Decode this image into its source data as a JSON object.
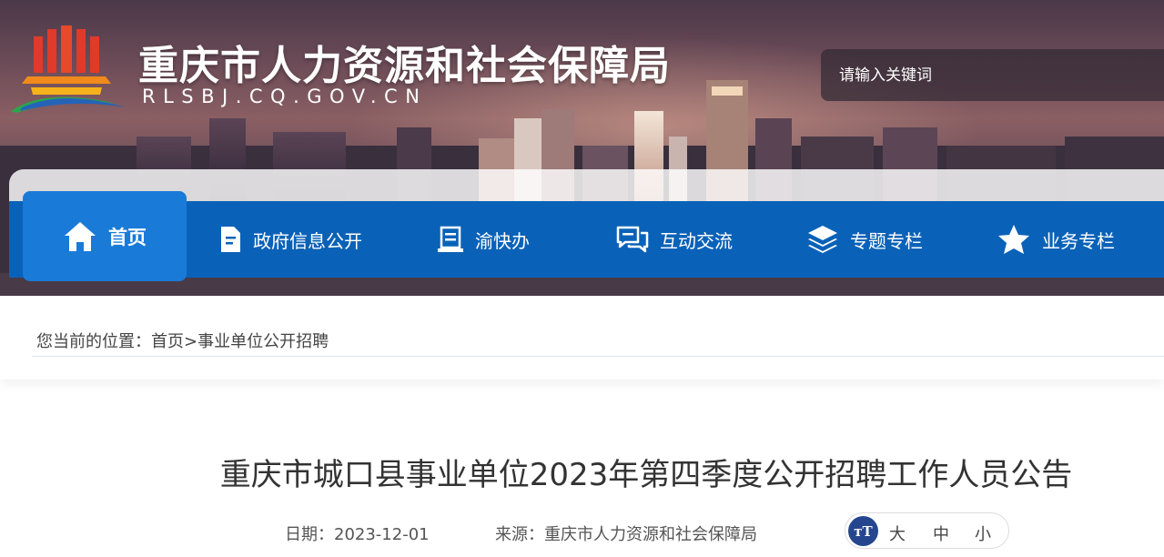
{
  "header": {
    "site_name": "重庆市人力资源和社会保障局",
    "site_domain": "RLSBJ.CQ.GOV.CN",
    "search_placeholder": "请输入关键词"
  },
  "nav": {
    "items": [
      {
        "label": "首页",
        "icon": "home-icon",
        "active": true
      },
      {
        "label": "政府信息公开",
        "icon": "document-icon"
      },
      {
        "label": "渝快办",
        "icon": "clipboard-icon"
      },
      {
        "label": "互动交流",
        "icon": "chat-icon"
      },
      {
        "label": "专题专栏",
        "icon": "layers-icon"
      },
      {
        "label": "业务专栏",
        "icon": "star-icon"
      }
    ]
  },
  "breadcrumb": {
    "prefix": "您当前的位置：",
    "home": "首页",
    "separator": ">",
    "current": "事业单位公开招聘"
  },
  "article": {
    "title": "重庆市城口县事业单位2023年第四季度公开招聘工作人员公告",
    "date_label": "日期：",
    "date": "2023-12-01",
    "source_label": "来源：",
    "source": "重庆市人力资源和社会保障局",
    "font_icon_text": "тT",
    "font_large": "大",
    "font_medium": "中",
    "font_small": "小"
  },
  "colors": {
    "nav_bg": "#0a62b8",
    "nav_active_bg": "#1a7ad8",
    "font_icon_bg": "#25468f"
  }
}
